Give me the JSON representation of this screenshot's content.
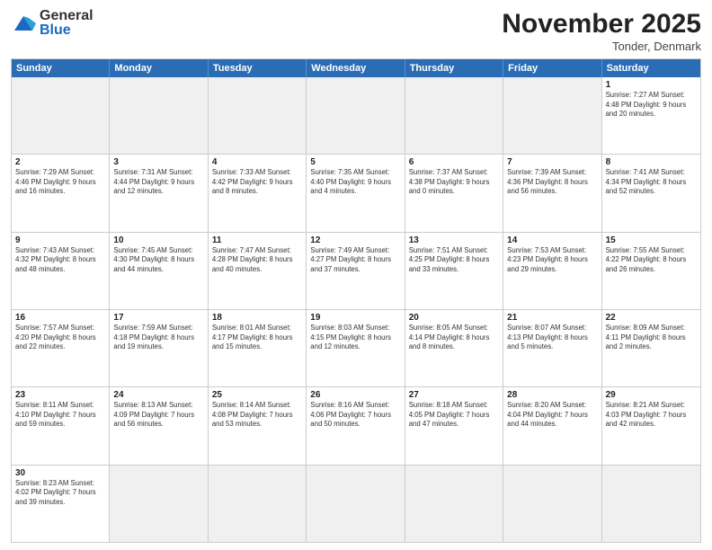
{
  "logo": {
    "general": "General",
    "blue": "Blue"
  },
  "title": "November 2025",
  "subtitle": "Tonder, Denmark",
  "days": [
    "Sunday",
    "Monday",
    "Tuesday",
    "Wednesday",
    "Thursday",
    "Friday",
    "Saturday"
  ],
  "weeks": [
    [
      {
        "num": "",
        "info": "",
        "empty": true
      },
      {
        "num": "",
        "info": "",
        "empty": true
      },
      {
        "num": "",
        "info": "",
        "empty": true
      },
      {
        "num": "",
        "info": "",
        "empty": true
      },
      {
        "num": "",
        "info": "",
        "empty": true
      },
      {
        "num": "",
        "info": "",
        "empty": true
      },
      {
        "num": "1",
        "info": "Sunrise: 7:27 AM\nSunset: 4:48 PM\nDaylight: 9 hours\nand 20 minutes."
      }
    ],
    [
      {
        "num": "2",
        "info": "Sunrise: 7:29 AM\nSunset: 4:46 PM\nDaylight: 9 hours\nand 16 minutes."
      },
      {
        "num": "3",
        "info": "Sunrise: 7:31 AM\nSunset: 4:44 PM\nDaylight: 9 hours\nand 12 minutes."
      },
      {
        "num": "4",
        "info": "Sunrise: 7:33 AM\nSunset: 4:42 PM\nDaylight: 9 hours\nand 8 minutes."
      },
      {
        "num": "5",
        "info": "Sunrise: 7:35 AM\nSunset: 4:40 PM\nDaylight: 9 hours\nand 4 minutes."
      },
      {
        "num": "6",
        "info": "Sunrise: 7:37 AM\nSunset: 4:38 PM\nDaylight: 9 hours\nand 0 minutes."
      },
      {
        "num": "7",
        "info": "Sunrise: 7:39 AM\nSunset: 4:36 PM\nDaylight: 8 hours\nand 56 minutes."
      },
      {
        "num": "8",
        "info": "Sunrise: 7:41 AM\nSunset: 4:34 PM\nDaylight: 8 hours\nand 52 minutes."
      }
    ],
    [
      {
        "num": "9",
        "info": "Sunrise: 7:43 AM\nSunset: 4:32 PM\nDaylight: 8 hours\nand 48 minutes."
      },
      {
        "num": "10",
        "info": "Sunrise: 7:45 AM\nSunset: 4:30 PM\nDaylight: 8 hours\nand 44 minutes."
      },
      {
        "num": "11",
        "info": "Sunrise: 7:47 AM\nSunset: 4:28 PM\nDaylight: 8 hours\nand 40 minutes."
      },
      {
        "num": "12",
        "info": "Sunrise: 7:49 AM\nSunset: 4:27 PM\nDaylight: 8 hours\nand 37 minutes."
      },
      {
        "num": "13",
        "info": "Sunrise: 7:51 AM\nSunset: 4:25 PM\nDaylight: 8 hours\nand 33 minutes."
      },
      {
        "num": "14",
        "info": "Sunrise: 7:53 AM\nSunset: 4:23 PM\nDaylight: 8 hours\nand 29 minutes."
      },
      {
        "num": "15",
        "info": "Sunrise: 7:55 AM\nSunset: 4:22 PM\nDaylight: 8 hours\nand 26 minutes."
      }
    ],
    [
      {
        "num": "16",
        "info": "Sunrise: 7:57 AM\nSunset: 4:20 PM\nDaylight: 8 hours\nand 22 minutes."
      },
      {
        "num": "17",
        "info": "Sunrise: 7:59 AM\nSunset: 4:18 PM\nDaylight: 8 hours\nand 19 minutes."
      },
      {
        "num": "18",
        "info": "Sunrise: 8:01 AM\nSunset: 4:17 PM\nDaylight: 8 hours\nand 15 minutes."
      },
      {
        "num": "19",
        "info": "Sunrise: 8:03 AM\nSunset: 4:15 PM\nDaylight: 8 hours\nand 12 minutes."
      },
      {
        "num": "20",
        "info": "Sunrise: 8:05 AM\nSunset: 4:14 PM\nDaylight: 8 hours\nand 8 minutes."
      },
      {
        "num": "21",
        "info": "Sunrise: 8:07 AM\nSunset: 4:13 PM\nDaylight: 8 hours\nand 5 minutes."
      },
      {
        "num": "22",
        "info": "Sunrise: 8:09 AM\nSunset: 4:11 PM\nDaylight: 8 hours\nand 2 minutes."
      }
    ],
    [
      {
        "num": "23",
        "info": "Sunrise: 8:11 AM\nSunset: 4:10 PM\nDaylight: 7 hours\nand 59 minutes."
      },
      {
        "num": "24",
        "info": "Sunrise: 8:13 AM\nSunset: 4:09 PM\nDaylight: 7 hours\nand 56 minutes."
      },
      {
        "num": "25",
        "info": "Sunrise: 8:14 AM\nSunset: 4:08 PM\nDaylight: 7 hours\nand 53 minutes."
      },
      {
        "num": "26",
        "info": "Sunrise: 8:16 AM\nSunset: 4:06 PM\nDaylight: 7 hours\nand 50 minutes."
      },
      {
        "num": "27",
        "info": "Sunrise: 8:18 AM\nSunset: 4:05 PM\nDaylight: 7 hours\nand 47 minutes."
      },
      {
        "num": "28",
        "info": "Sunrise: 8:20 AM\nSunset: 4:04 PM\nDaylight: 7 hours\nand 44 minutes."
      },
      {
        "num": "29",
        "info": "Sunrise: 8:21 AM\nSunset: 4:03 PM\nDaylight: 7 hours\nand 42 minutes."
      }
    ],
    [
      {
        "num": "30",
        "info": "Sunrise: 8:23 AM\nSunset: 4:02 PM\nDaylight: 7 hours\nand 39 minutes."
      },
      {
        "num": "",
        "info": "",
        "empty": true
      },
      {
        "num": "",
        "info": "",
        "empty": true
      },
      {
        "num": "",
        "info": "",
        "empty": true
      },
      {
        "num": "",
        "info": "",
        "empty": true
      },
      {
        "num": "",
        "info": "",
        "empty": true
      },
      {
        "num": "",
        "info": "",
        "empty": true
      }
    ]
  ]
}
